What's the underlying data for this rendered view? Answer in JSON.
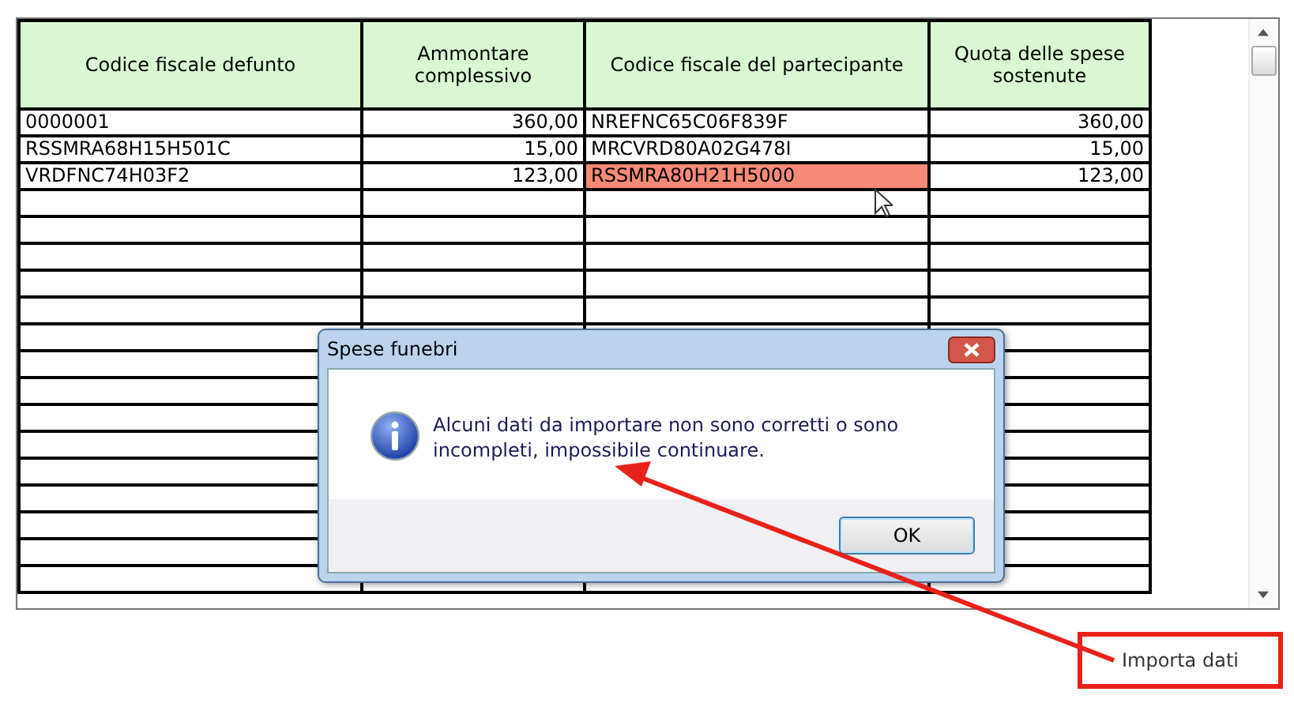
{
  "table": {
    "columns": [
      "Codice fiscale defunto",
      "Ammontare complessivo",
      "Codice fiscale del partecipante",
      "Quota delle spese sostenute"
    ],
    "rows": [
      {
        "defunto": "0000001",
        "ammontare": "360,00",
        "partecipante": "NREFNC65C06F839F",
        "quota": "360,00",
        "partecipante_error": false
      },
      {
        "defunto": "RSSMRA68H15H501C",
        "ammontare": "15,00",
        "partecipante": "MRCVRD80A02G478I",
        "quota": "15,00",
        "partecipante_error": false
      },
      {
        "defunto": "VRDFNC74H03F2",
        "ammontare": "123,00",
        "partecipante": "RSSMRA80H21H5000",
        "quota": "123,00",
        "partecipante_error": true
      }
    ]
  },
  "dialog": {
    "title": "Spese funebri",
    "message": "Alcuni dati da importare non sono corretti o sono incompleti, impossibile continuare.",
    "buttons": [
      "OK"
    ]
  },
  "annotation": {
    "label": "Importa dati"
  }
}
